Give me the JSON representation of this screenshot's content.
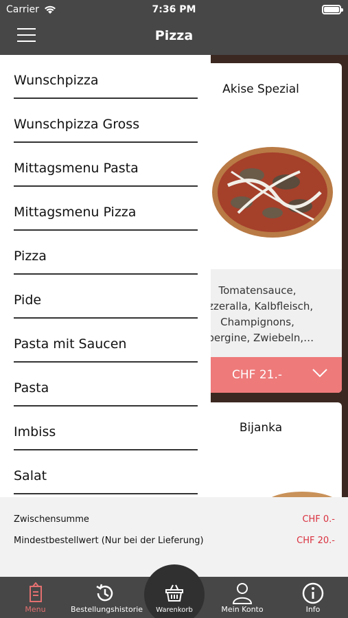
{
  "status_bar": {
    "carrier": "Carrier",
    "time": "7:36 PM"
  },
  "header": {
    "title": "Pizza"
  },
  "drawer": {
    "items": [
      {
        "label": "Wunschpizza"
      },
      {
        "label": "Wunschpizza Gross"
      },
      {
        "label": "Mittagsmenu Pasta"
      },
      {
        "label": "Mittagsmenu Pizza"
      },
      {
        "label": "Pizza"
      },
      {
        "label": "Pide"
      },
      {
        "label": "Pasta mit Saucen"
      },
      {
        "label": "Pasta"
      },
      {
        "label": "Imbiss"
      },
      {
        "label": "Salat"
      }
    ]
  },
  "products": [
    {
      "name": "Akise Spezial",
      "description_lines": [
        "Tomatensauce,",
        "ozzeralla, Kalbfleisch,",
        "Champignons,",
        "ubergine, Zwiebeln,…"
      ],
      "price": "CHF 21.-"
    },
    {
      "name": "Bijanka"
    }
  ],
  "summary": {
    "subtotal_label": "Zwischensumme",
    "subtotal_value": "CHF 0.-",
    "minimum_label": "Mindestbestellwert (Nur bei der Lieferung)",
    "minimum_value": "CHF 20.-"
  },
  "tabbar": {
    "tabs": [
      {
        "label": "Menu",
        "icon": "menu-card-icon",
        "active": true
      },
      {
        "label": "Bestellungshistorie",
        "icon": "history-icon",
        "active": false
      },
      {
        "label": "Warenkorb",
        "icon": "basket-icon",
        "active": false
      },
      {
        "label": "Mein Konto",
        "icon": "user-icon",
        "active": false
      },
      {
        "label": "Info",
        "icon": "info-icon",
        "active": false
      }
    ]
  },
  "colors": {
    "header": "#474747",
    "accent": "#ee7a7a",
    "price_red": "#d9303e"
  }
}
